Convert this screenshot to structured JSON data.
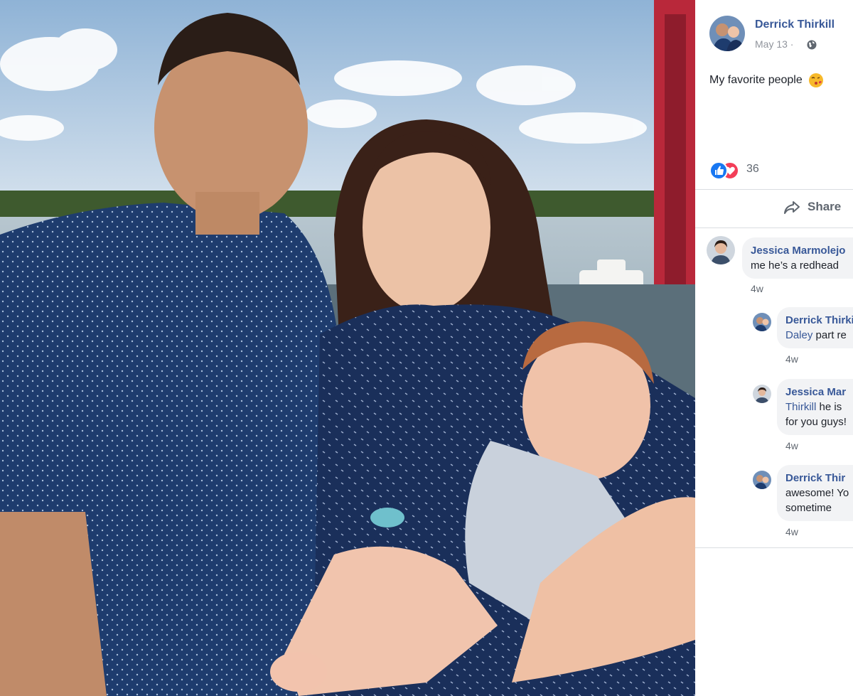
{
  "post": {
    "author": "Derrick Thirkill",
    "date": "May 13",
    "caption": "My favorite people",
    "reaction_count": "36",
    "share_label": "Share"
  },
  "comments": [
    {
      "author": "Jessica Marmolejo",
      "text": "me he’s a redhead",
      "time": "4w"
    },
    {
      "author": "Derrick Thirkill",
      "mention": "Daley",
      "text": "part re",
      "time": "4w"
    },
    {
      "author": "Jessica Mar",
      "mention": "Thirkill",
      "text": "he is",
      "text2": "for you guys!",
      "time": "4w"
    },
    {
      "author": "Derrick Thir",
      "text": "awesome! Yo",
      "text2": "sometime",
      "time": "4w"
    }
  ],
  "icons": {
    "privacy": "globe-icon",
    "like": "like-reaction-icon",
    "love": "love-reaction-icon",
    "share": "share-arrow-icon",
    "emoji": "kissing-face-emoji"
  },
  "colors": {
    "link": "#385898",
    "like": "#1877f2",
    "love": "#f33e58",
    "bubble": "#f2f3f5"
  }
}
